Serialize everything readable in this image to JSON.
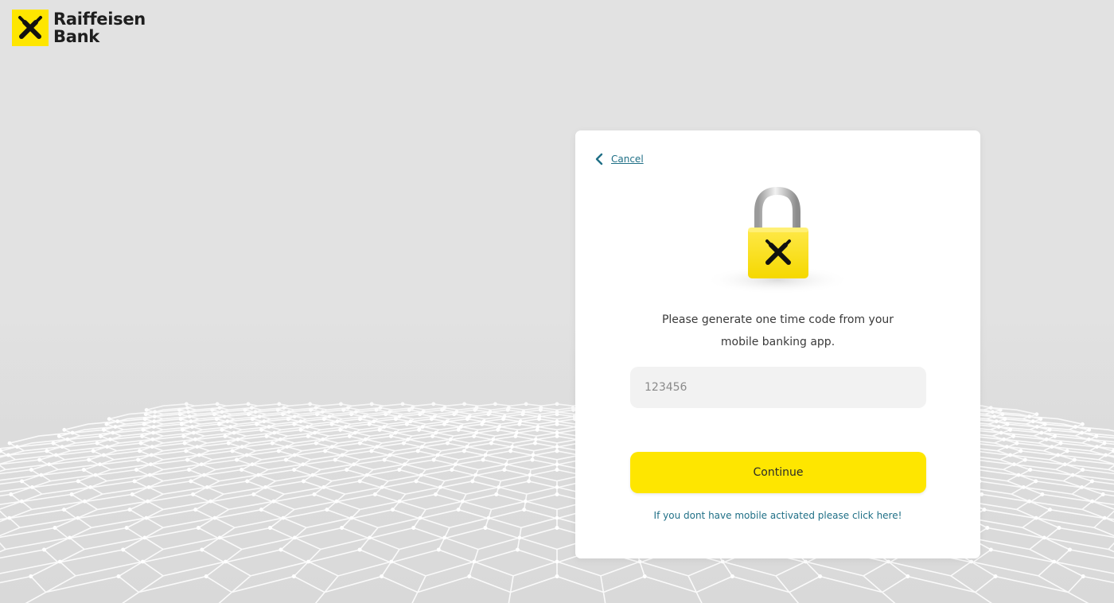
{
  "brand": {
    "name_line1": "Raiffeisen",
    "name_line2": "Bank",
    "accent": "#fee600",
    "link_color": "#1f6f86"
  },
  "auth_card": {
    "cancel_label": "Cancel",
    "prompt_line1": "Please generate one time code from your",
    "prompt_line2": "mobile banking app.",
    "code_input": {
      "value": "",
      "placeholder": "123456"
    },
    "continue_label": "Continue",
    "help_link": "If you dont have mobile activated please click here!"
  },
  "icons": {
    "cancel": "chevron-left-icon",
    "logo": "raiffeisen-cross-icon",
    "lock": "padlock-icon"
  }
}
